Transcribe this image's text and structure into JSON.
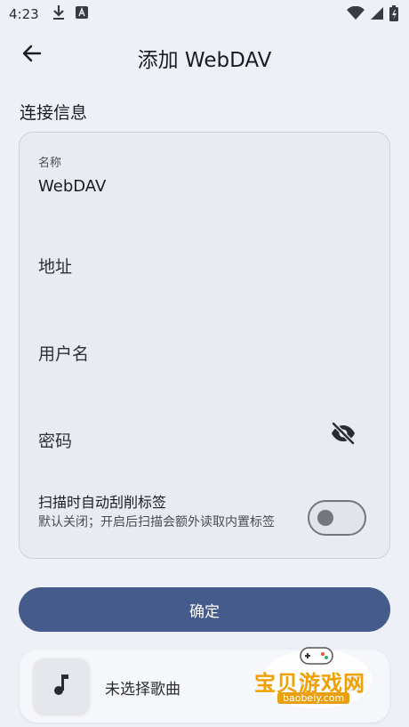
{
  "status_bar": {
    "time": "4:23"
  },
  "app_bar": {
    "title": "添加 WebDAV"
  },
  "section": {
    "title": "连接信息"
  },
  "form": {
    "name": {
      "label": "名称",
      "value": "WebDAV"
    },
    "address": {
      "placeholder": "地址"
    },
    "username": {
      "placeholder": "用户名"
    },
    "password": {
      "placeholder": "密码"
    },
    "scrape": {
      "title": "扫描时自动刮削标签",
      "description": "默认关闭；开启后扫描会额外读取内置标签",
      "enabled": false
    }
  },
  "confirm_label": "确定",
  "player": {
    "title": "未选择歌曲"
  },
  "watermark": {
    "text": "宝贝游戏网",
    "url": "baobeiy.com"
  },
  "colors": {
    "accent": "#455b8c",
    "background": "#eef0f8",
    "card": "#e9ebf3"
  },
  "icons": {
    "back": "arrow-left-icon",
    "eye": "eye-off-icon",
    "music": "music-note-icon",
    "controls": [
      "skip-previous-icon",
      "playlist-icon"
    ]
  }
}
